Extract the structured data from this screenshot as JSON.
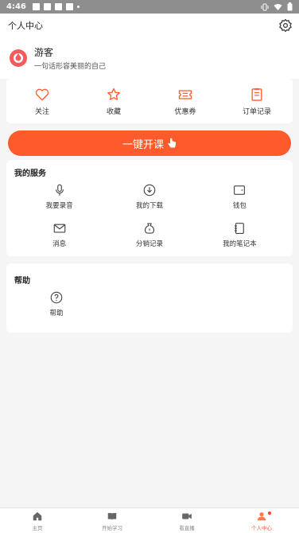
{
  "status_bar": {
    "time": "4:46"
  },
  "header": {
    "title": "个人中心"
  },
  "profile": {
    "name": "游客",
    "motto": "一句话形容美丽的自己"
  },
  "quick_links": [
    {
      "label": "关注",
      "icon": "heart-icon"
    },
    {
      "label": "收藏",
      "icon": "star-icon"
    },
    {
      "label": "优惠券",
      "icon": "coupon-icon"
    },
    {
      "label": "订单记录",
      "icon": "order-icon"
    }
  ],
  "cta": {
    "label": "一键开课"
  },
  "services": {
    "title": "我的服务",
    "items": [
      {
        "label": "我要录音",
        "icon": "microphone-icon"
      },
      {
        "label": "我的下载",
        "icon": "download-icon"
      },
      {
        "label": "钱包",
        "icon": "wallet-icon"
      },
      {
        "label": "消息",
        "icon": "mail-icon"
      },
      {
        "label": "分销记录",
        "icon": "money-bag-icon"
      },
      {
        "label": "我的笔记本",
        "icon": "notebook-icon"
      }
    ]
  },
  "help": {
    "title": "帮助",
    "items": [
      {
        "label": "帮助",
        "icon": "question-icon"
      }
    ]
  },
  "tabbar": [
    {
      "label": "主页",
      "icon": "home-icon",
      "active": false
    },
    {
      "label": "开始学习",
      "icon": "book-icon",
      "active": false
    },
    {
      "label": "看直播",
      "icon": "video-icon",
      "active": false
    },
    {
      "label": "个人中心",
      "icon": "user-icon",
      "active": true
    }
  ],
  "colors": {
    "accent": "#ff5a2c",
    "status_bar": "#8e8e8e"
  }
}
